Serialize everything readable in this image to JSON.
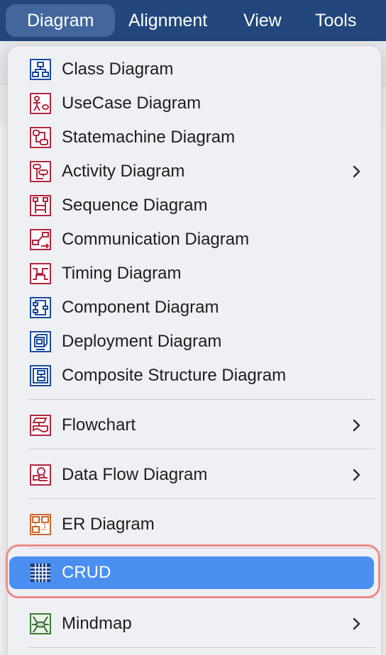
{
  "menubar": {
    "items": [
      {
        "label": "Diagram",
        "active": true
      },
      {
        "label": "Alignment"
      },
      {
        "label": "View"
      },
      {
        "label": "Tools"
      }
    ]
  },
  "menu": {
    "items": [
      {
        "label": "Class Diagram",
        "icon": "class-diagram-icon"
      },
      {
        "label": "UseCase Diagram",
        "icon": "usecase-diagram-icon"
      },
      {
        "label": "Statemachine Diagram",
        "icon": "statemachine-diagram-icon"
      },
      {
        "label": "Activity Diagram",
        "icon": "activity-diagram-icon",
        "submenu": true
      },
      {
        "label": "Sequence Diagram",
        "icon": "sequence-diagram-icon"
      },
      {
        "label": "Communication Diagram",
        "icon": "communication-diagram-icon"
      },
      {
        "label": "Timing Diagram",
        "icon": "timing-diagram-icon"
      },
      {
        "label": "Component Diagram",
        "icon": "component-diagram-icon"
      },
      {
        "label": "Deployment Diagram",
        "icon": "deployment-diagram-icon"
      },
      {
        "label": "Composite Structure Diagram",
        "icon": "composite-structure-diagram-icon"
      },
      {
        "label": "Flowchart",
        "icon": "flowchart-icon",
        "submenu": true
      },
      {
        "label": "Data Flow Diagram",
        "icon": "data-flow-diagram-icon",
        "submenu": true
      },
      {
        "label": "ER Diagram",
        "icon": "er-diagram-icon"
      },
      {
        "label": "CRUD",
        "icon": "crud-icon",
        "selected": true
      },
      {
        "label": "Mindmap",
        "icon": "mindmap-icon",
        "submenu": true
      }
    ]
  },
  "colors": {
    "menubar": "#21477c",
    "selection": "#4a8ff0",
    "focus_ring": "#f08a86",
    "uml_blue": "#1a4a9c",
    "uml_red": "#b3263f",
    "er_orange": "#d0652c",
    "mindmap_green": "#3f7a3a"
  }
}
